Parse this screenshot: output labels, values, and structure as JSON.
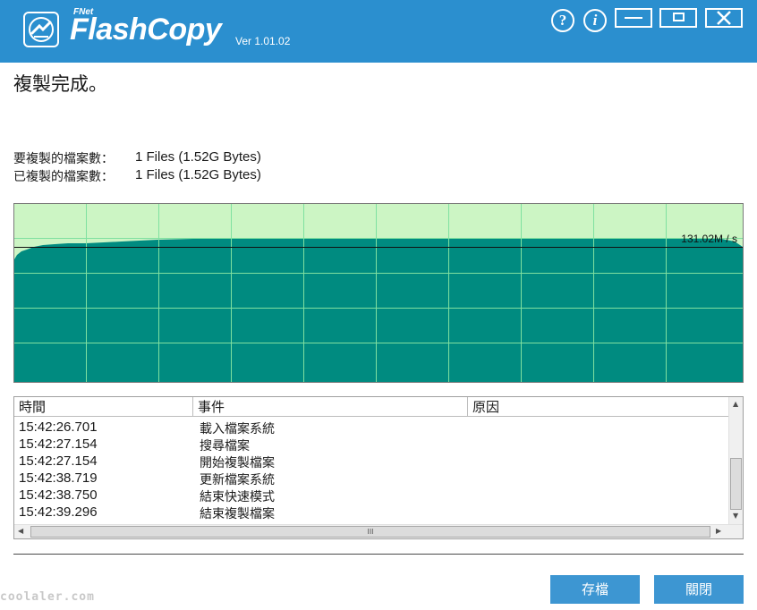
{
  "app": {
    "brand_prefix": "FNet",
    "brand_name": "FlashCopy",
    "version": "Ver 1.01.02"
  },
  "window_controls": {
    "help_glyph": "?",
    "info_glyph": "i",
    "minimize": "minimize-icon",
    "maximize": "maximize-icon",
    "close": "close-icon"
  },
  "status_text": "複製完成。",
  "counts": {
    "to_copy_label": "要複製的檔案數：",
    "to_copy_value": "1 Files (1.52G Bytes)",
    "copied_label": "已複製的檔案數：",
    "copied_value": "1 Files (1.52G Bytes)"
  },
  "throughput": {
    "speed_label": "131.02M / s",
    "colors": {
      "fill": "#008b80",
      "background": "#ccf5c4",
      "grid": "#7fe0a0"
    }
  },
  "log": {
    "columns": [
      "時間",
      "事件",
      "原因"
    ],
    "rows": [
      {
        "time": "15:42:26.701",
        "event": "載入檔案系統",
        "reason": ""
      },
      {
        "time": "15:42:27.154",
        "event": "搜尋檔案",
        "reason": ""
      },
      {
        "time": "15:42:27.154",
        "event": "開始複製檔案",
        "reason": ""
      },
      {
        "time": "15:42:38.719",
        "event": "更新檔案系統",
        "reason": ""
      },
      {
        "time": "15:42:38.750",
        "event": "結束快速模式",
        "reason": ""
      },
      {
        "time": "15:42:39.296",
        "event": "結束複製檔案",
        "reason": ""
      }
    ],
    "hscroll_grip": "III"
  },
  "buttons": {
    "save": "存檔",
    "close": "關閉"
  },
  "watermark": "coolaler.com"
}
